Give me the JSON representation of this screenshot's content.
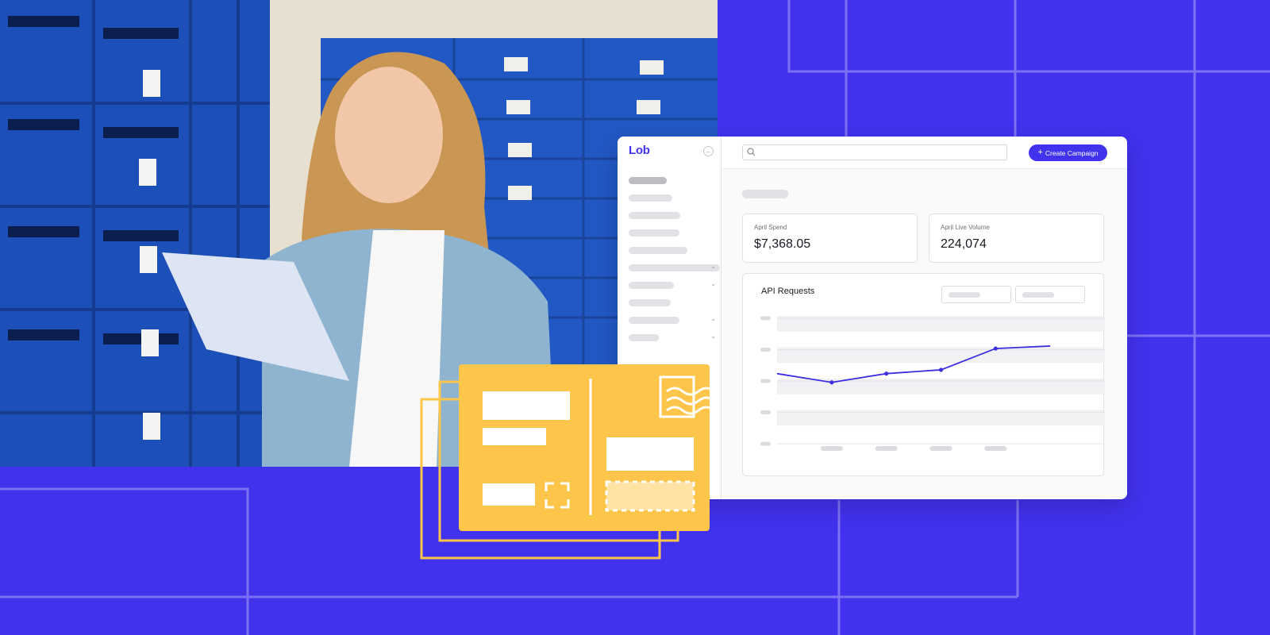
{
  "app": {
    "logo": "Lob"
  },
  "header": {
    "cta_label": "Create Campaign",
    "cta_icon": "plus-icon",
    "search_icon": "search-icon"
  },
  "sidebar": {
    "collapse_icon": "arrow-left-icon",
    "items": [
      {
        "active": true,
        "has_chevron": false
      },
      {
        "active": false,
        "has_chevron": false
      },
      {
        "active": false,
        "has_chevron": false
      },
      {
        "active": false,
        "has_chevron": false
      },
      {
        "active": false,
        "has_chevron": false
      },
      {
        "active": false,
        "has_chevron": true
      },
      {
        "active": false,
        "has_chevron": true
      },
      {
        "active": false,
        "has_chevron": false
      },
      {
        "active": false,
        "has_chevron": true
      },
      {
        "active": false,
        "has_chevron": true
      }
    ]
  },
  "stats": [
    {
      "label": "April Spend",
      "value": "$7,368.05"
    },
    {
      "label": "April Live Volume",
      "value": "224,074"
    }
  ],
  "chart_data": {
    "type": "line",
    "title": "API Requests",
    "x": [
      0,
      1,
      2,
      3,
      4,
      5,
      6
    ],
    "series": [
      {
        "values": [
          54,
          47,
          54,
          57,
          74,
          76
        ]
      }
    ],
    "ylim": [
      0,
      100
    ],
    "xlim": [
      0,
      6
    ],
    "points_marked": [
      1,
      2,
      3,
      4
    ],
    "grid": true,
    "line_color": "#3D2FE0",
    "band_color": "#F1F1F3"
  },
  "colors": {
    "brand": "#4132EE",
    "accent_yellow": "#FDC54A",
    "grid_line": "#7C71F3"
  }
}
